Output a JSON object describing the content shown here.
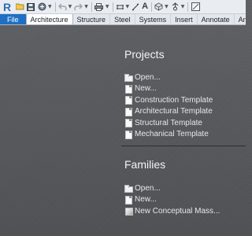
{
  "app": {
    "logo_letter": "R",
    "accent_color": "#1f6fc4"
  },
  "quick_access": {
    "icons": [
      "open-icon",
      "save-icon",
      "sync-icon",
      "undo-icon",
      "redo-icon",
      "print-icon",
      "measure-icon",
      "dimension-icon",
      "text-icon",
      "3d-view-icon",
      "section-icon",
      "close-hidden-icon"
    ]
  },
  "ribbon": {
    "tabs": [
      {
        "label": "File"
      },
      {
        "label": "Architecture"
      },
      {
        "label": "Structure"
      },
      {
        "label": "Steel"
      },
      {
        "label": "Systems"
      },
      {
        "label": "Insert"
      },
      {
        "label": "Annotate"
      },
      {
        "label": "Ana"
      }
    ]
  },
  "projects": {
    "title": "Projects",
    "items": [
      {
        "label": "Open...",
        "icon": "folder-icon"
      },
      {
        "label": "New...",
        "icon": "document-icon"
      },
      {
        "label": "Construction Template",
        "icon": "document-icon"
      },
      {
        "label": "Architectural Template",
        "icon": "document-icon"
      },
      {
        "label": "Structural Template",
        "icon": "document-icon"
      },
      {
        "label": "Mechanical Template",
        "icon": "document-icon"
      }
    ]
  },
  "families": {
    "title": "Families",
    "items": [
      {
        "label": "Open...",
        "icon": "folder-icon"
      },
      {
        "label": "New...",
        "icon": "document-icon"
      },
      {
        "label": "New Conceptual Mass...",
        "icon": "mass-icon"
      }
    ]
  }
}
